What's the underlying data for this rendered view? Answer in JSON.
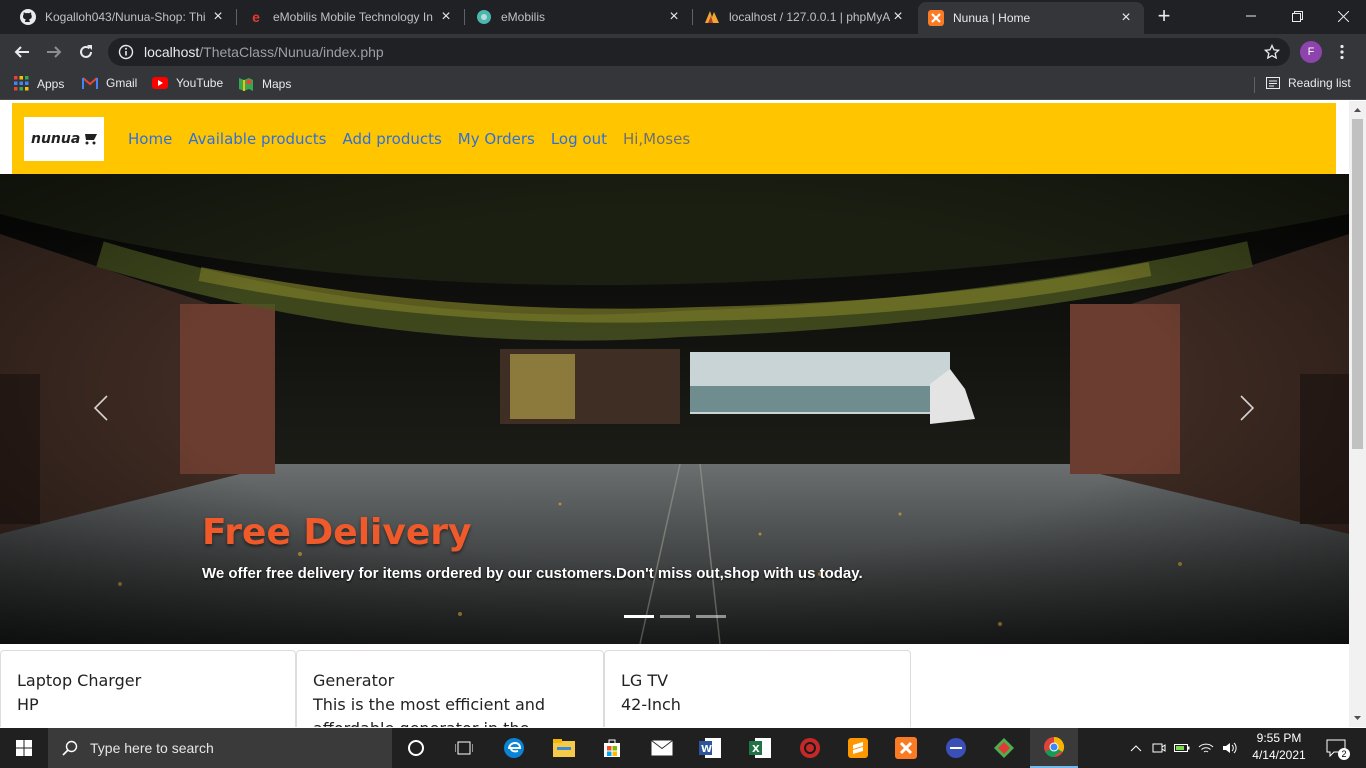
{
  "browser": {
    "tabs": [
      {
        "title": "Kogalloh043/Nunua-Shop: Thi",
        "icon": "github-icon"
      },
      {
        "title": "eMobilis Mobile Technology In",
        "icon": "emobilis-e-icon"
      },
      {
        "title": "eMobilis",
        "icon": "emobilis-globe-icon"
      },
      {
        "title": "localhost / 127.0.0.1 | phpMyA",
        "icon": "phpmyadmin-icon"
      },
      {
        "title": "Nunua | Home",
        "icon": "xampp-icon",
        "active": true
      }
    ],
    "url_host": "localhost",
    "url_path": "/ThetaClass/Nunua/index.php",
    "profile_initial": "F",
    "bookmarks": [
      {
        "label": "Apps",
        "icon": "apps-grid-icon"
      },
      {
        "label": "Gmail",
        "icon": "gmail-icon"
      },
      {
        "label": "YouTube",
        "icon": "youtube-icon"
      },
      {
        "label": "Maps",
        "icon": "maps-icon"
      }
    ],
    "reading_list": "Reading list"
  },
  "site": {
    "logo_text": "nunua",
    "nav": {
      "home": "Home",
      "available": "Available products",
      "add": "Add products",
      "orders": "My Orders",
      "logout": "Log out",
      "greeting": "Hi,Moses"
    },
    "colors": {
      "navbar": "#ffc600",
      "link": "#2f6fdb",
      "caption_title": "#f05a2a"
    },
    "carousel": {
      "title": "Free Delivery",
      "text": "We offer free delivery for items ordered by our customers.Don't miss out,shop with us today.",
      "active_slide": 1,
      "slide_count": 3
    },
    "products": [
      {
        "name": "Laptop Charger",
        "desc": "HP"
      },
      {
        "name": "Generator",
        "desc": "This is the most efficient and affordable generator in the market"
      },
      {
        "name": "LG TV",
        "desc": "42-Inch"
      }
    ]
  },
  "taskbar": {
    "search_placeholder": "Type here to search",
    "time": "9:55 PM",
    "date": "4/14/2021",
    "notifications": "2"
  }
}
